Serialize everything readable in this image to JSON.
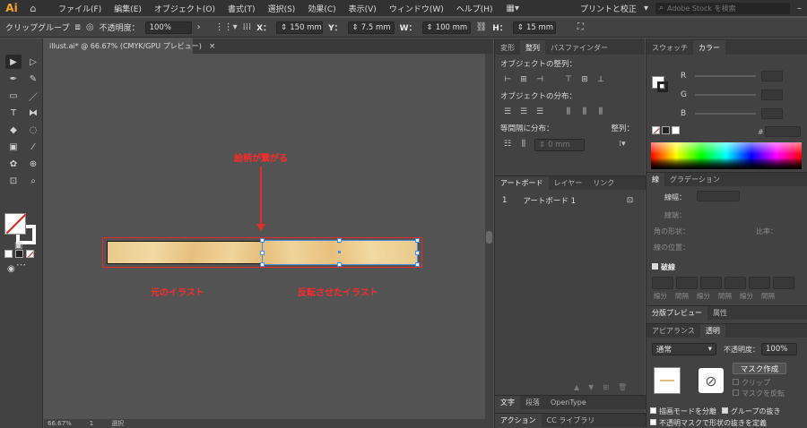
{
  "menubar": {
    "logo": "Ai",
    "items": [
      "ファイル(F)",
      "編集(E)",
      "オブジェクト(O)",
      "書式(T)",
      "選択(S)",
      "効果(C)",
      "表示(V)",
      "ウィンドウ(W)",
      "ヘルプ(H)"
    ],
    "print_label": "プリントと校正",
    "stock_placeholder": "Adobe Stock を検索"
  },
  "controlbar": {
    "selection_label": "クリップグループ",
    "opacity_label": "不透明度：",
    "opacity_value": "100%",
    "x_label": "X：",
    "x_value": "150 mm",
    "y_label": "Y：",
    "y_value": "7.5 mm",
    "w_label": "W：",
    "w_value": "100 mm",
    "h_label": "H：",
    "h_value": "15 mm"
  },
  "document": {
    "tab_title": "illust.ai* @ 66.67% (CMYK/GPU プレビュー)",
    "status_zoom": "66.67%",
    "status_page": "1",
    "status_tool": "選択"
  },
  "annotations": {
    "top": "絵柄が繋がる",
    "left": "元のイラスト",
    "right": "反転させたイラスト"
  },
  "align_panel": {
    "tabs": [
      "変形",
      "整列",
      "パスファインダー"
    ],
    "active_tab": "整列",
    "align_objects": "オブジェクトの整列：",
    "distribute_objects": "オブジェクトの分布：",
    "distribute_spacing": "等間隔に分布：",
    "align_to": "整列：",
    "spacing_value": "0 mm"
  },
  "artboard_panel": {
    "tabs": [
      "アートボード",
      "レイヤー",
      "リンク"
    ],
    "row_index": "1",
    "row_name": "アートボード 1"
  },
  "type_panel": {
    "tabs": [
      "文字",
      "段落",
      "OpenType"
    ],
    "bottom_tabs": [
      "アクション",
      "CC ライブラリ"
    ]
  },
  "color_panel": {
    "tabs": [
      "スウォッチ",
      "カラー"
    ],
    "r": "R",
    "g": "G",
    "b": "B",
    "hash": "#"
  },
  "stroke_panel": {
    "tabs": [
      "線",
      "グラデーション"
    ],
    "weight_label": "線幅：",
    "cap_label": "線端：",
    "corner_label": "角の形状：",
    "ratio_label": "比率：",
    "align_label": "線の位置：",
    "dashed_label": "破線",
    "dash_labels": [
      "線分",
      "間隔",
      "線分",
      "間隔",
      "線分",
      "間隔"
    ]
  },
  "separation_panel": {
    "tabs": [
      "分版プレビュー",
      "属性"
    ]
  },
  "transparency_panel": {
    "tabs": [
      "アピアランス",
      "透明"
    ],
    "blend_mode": "通常",
    "opacity_label": "不透明度：",
    "opacity_value": "100%",
    "mask_button": "マスク作成",
    "clip_label": "クリップ",
    "invert_label": "マスクを反転",
    "isolate_label": "描画モードを分離",
    "knockout_label": "グループの抜き",
    "define_knockout": "不透明マスクで形状の抜きを定義"
  }
}
